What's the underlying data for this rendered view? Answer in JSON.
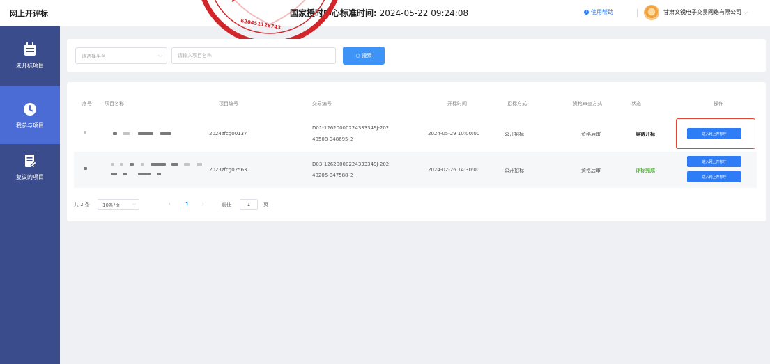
{
  "header": {
    "app_title": "网上开评标",
    "time_label": "国家授时中心标准时间:",
    "time_value": "2024-05-22 09:24:08",
    "help_link": "使用帮助",
    "company": "甘肃文锐电子交易网络有限公司"
  },
  "stamp": {
    "number": "620451128743"
  },
  "sidebar": {
    "items": [
      {
        "label": "未开标项目",
        "icon": "calendar-icon"
      },
      {
        "label": "我参与项目",
        "icon": "clock-icon",
        "active": true
      },
      {
        "label": "复议的项目",
        "icon": "document-edit-icon"
      }
    ]
  },
  "filters": {
    "platform_placeholder": "请选择平台",
    "project_placeholder": "请输入项目名称",
    "search_label": "搜索"
  },
  "table": {
    "columns": [
      "序号",
      "项目名称",
      "项目编号",
      "交易编号",
      "开标时间",
      "招标方式",
      "资格审查方式",
      "状态",
      "操作"
    ],
    "rows": [
      {
        "project_code": "2024zfcg00137",
        "trade_code_1": "D01-12620000224333349J-202",
        "trade_code_2": "40508-048695-2",
        "open_time": "2024-05-29 10:00:00",
        "method": "公开招标",
        "review": "资格后审",
        "status": "等待开标",
        "action": "进入网上开标厅"
      },
      {
        "project_code": "2023zfcg02563",
        "trade_code_1": "D03-12620000224333349J-202",
        "trade_code_2": "40205-047588-2",
        "open_time": "2024-02-26 14:30:00",
        "method": "公开招标",
        "review": "资格后审",
        "status": "评标完成",
        "action": "进入网上开标厅",
        "action2": "进入网上开标厅"
      }
    ]
  },
  "pagination": {
    "total": "共 2 条",
    "page_size": "10条/页",
    "current_page": "1",
    "goto_label": "前往",
    "goto_value": "1",
    "page_unit": "页"
  },
  "colors": {
    "sidebar_bg": "#3a4c8c",
    "sidebar_active": "#4a6cd4",
    "primary": "#2f7df6",
    "status_done": "#58b53e",
    "highlight": "#e4462f",
    "stamp": "#d3262b"
  }
}
